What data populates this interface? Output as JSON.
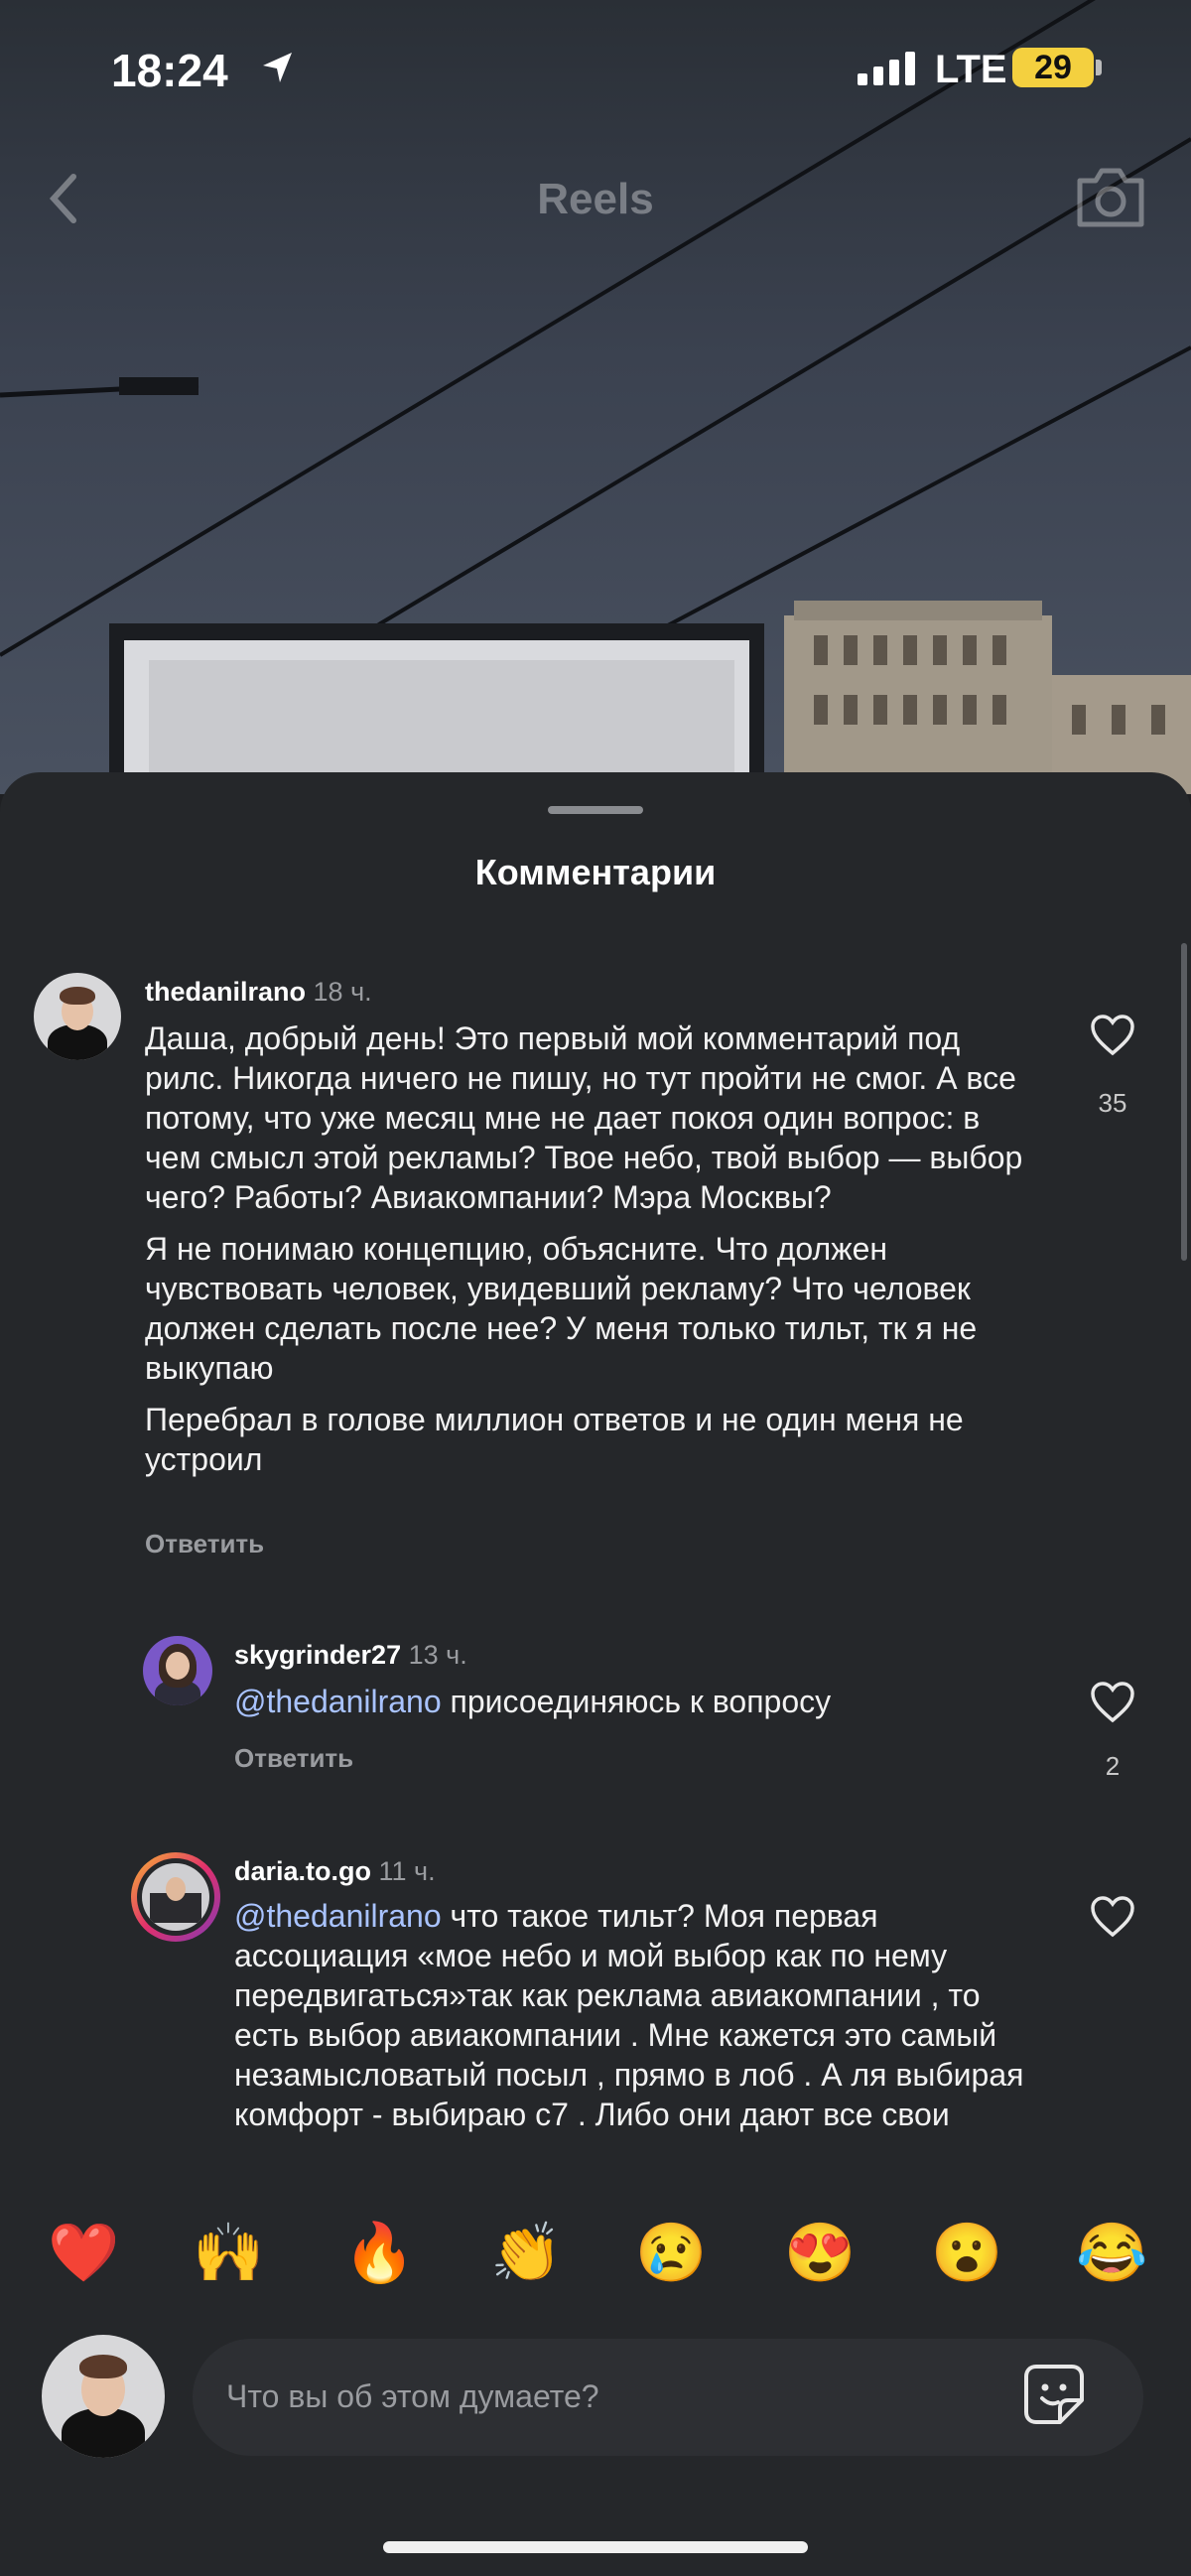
{
  "status_bar": {
    "time": "18:24",
    "network": "LTE",
    "battery": "29"
  },
  "nav": {
    "title": "Reels"
  },
  "sheet": {
    "title": "Комментарии"
  },
  "comments": [
    {
      "username": "thedanilrano",
      "time": "18 ч.",
      "paragraphs": [
        "Даша, добрый день! Это первый мой комментарий под рилс. Никогда ничего не пишу, но тут пройти не смог. А все потому, что уже месяц мне не дает покоя один вопрос: в чем смысл этой рекламы? Твое небо, твой выбор — выбор чего? Работы? Авиакомпании? Мэра Москвы?",
        "Я не понимаю концепцию, объясните. Что должен чувствовать человек, увидевший рекламу? Что человек должен сделать после нее? У меня только тильт, тк я не выкупаю",
        "Перебрал в голове миллион ответов и не один меня не устроил"
      ],
      "reply_label": "Ответить",
      "likes": "35"
    },
    {
      "username": "skygrinder27",
      "time": "13 ч.",
      "mention": "@thedanilrano",
      "text": " присоединяюсь к вопросу",
      "reply_label": "Ответить",
      "likes": "2"
    },
    {
      "username": "daria.to.go",
      "time": "11 ч.",
      "mention": "@thedanilrano",
      "text": " что такое тильт? Моя первая ассоциация «мое небо и мой выбор как по нему передвигаться»так как реклама авиакомпании , то есть выбор авиакомпании . Мне кажется это самый незамысловатый посыл , прямо в лоб . А ля выбирая комфорт - выбираю с7 . Либо они дают все свои"
    }
  ],
  "emojis": [
    "❤️",
    "🙌",
    "🔥",
    "👏",
    "😢",
    "😍",
    "😮",
    "😂"
  ],
  "input": {
    "placeholder": "Что вы об этом думаете?"
  }
}
